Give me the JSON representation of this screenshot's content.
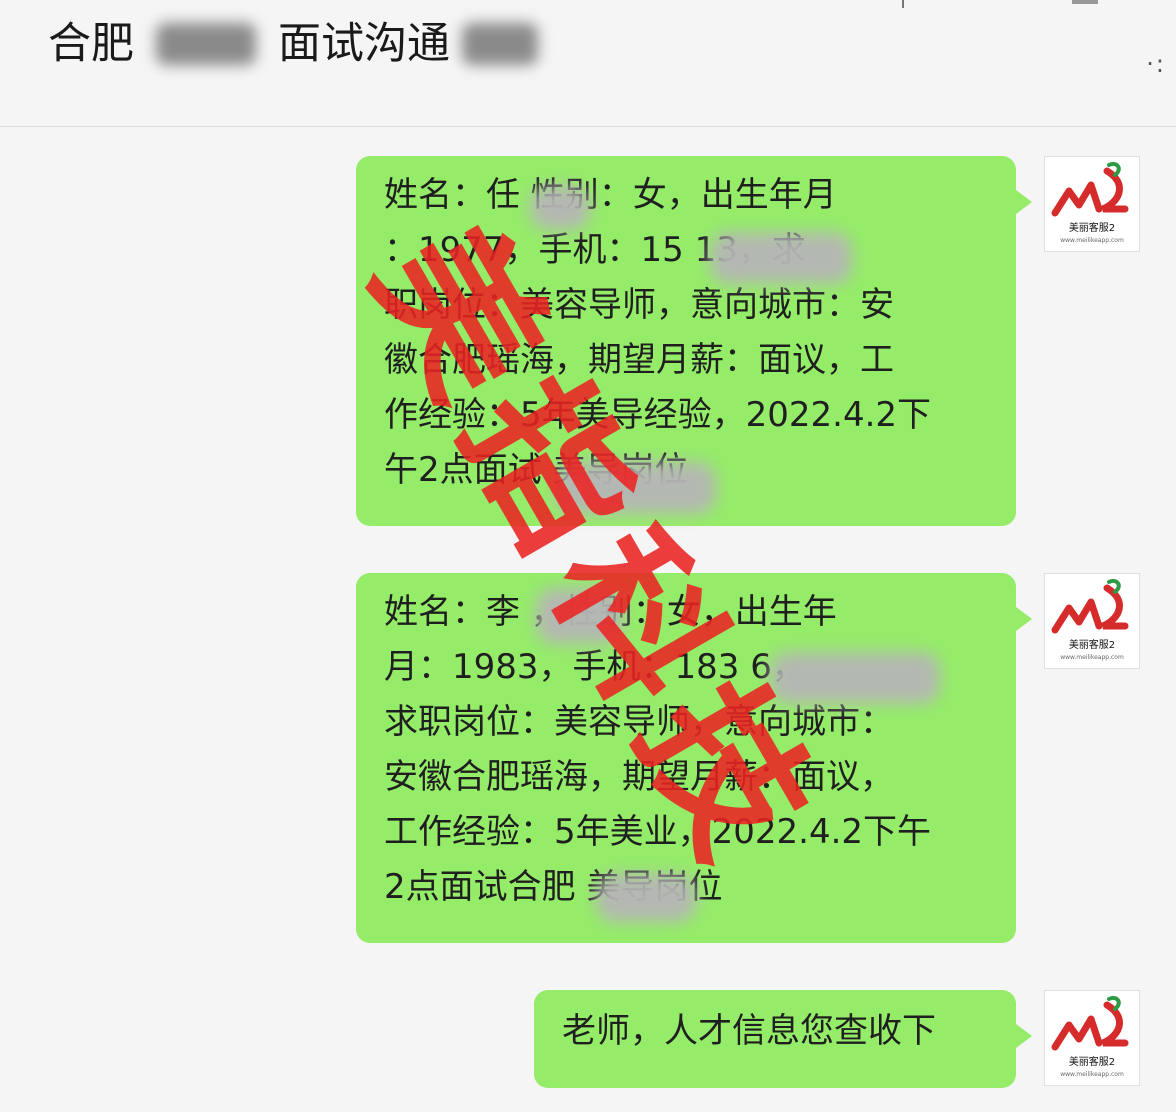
{
  "header": {
    "title_part1": "合肥",
    "title_part2": "面试沟通",
    "more_label": "·:"
  },
  "messages": [
    {
      "text": "姓名：任    性别：女，出生年月\n：1977，手机：15          13，求\n职岗位：美容导师，意向城市：安\n徽合肥瑶海，期望月薪：面议，工\n作经验：5年美导经验，2022.4.2下\n午2点面试      美导岗位"
    },
    {
      "text": "姓名：李      ，性别：女，出生年\n月：1983，手机：183          6，\n求职岗位：美容导师，意向城市：\n安徽合肥瑶海，期望月薪：面议，\n工作经验：5年美业，2022.4.2下午\n2点面试合肥      美导岗位"
    },
    {
      "text": "老师，人才信息您查收下"
    }
  ],
  "avatar": {
    "brand_text": "美丽客服2",
    "url_text": "www.meilikeapp.com",
    "icon": "brand-logo-icon",
    "accent_color": "#d52b2b"
  },
  "watermark": {
    "text": "美指科技",
    "color": "#eb2323"
  }
}
